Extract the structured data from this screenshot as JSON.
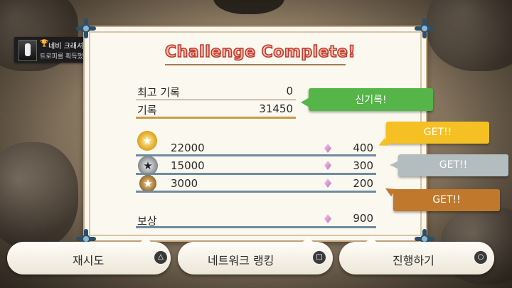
{
  "trophy": {
    "title": "네비 크래셔",
    "message": "트로피를 획득했습니다!",
    "cup_icon": "🏆",
    "ps_icon": "PS"
  },
  "title": "Challenge Complete!",
  "best_record": {
    "label": "최고 기록",
    "value": "0"
  },
  "record": {
    "label": "기록",
    "value": "31450"
  },
  "new_record_tag": "신기록!",
  "tiers": [
    {
      "medal": "gold-medal-icon",
      "score": "22000",
      "reward": "400",
      "tag": "GET!!",
      "tag_color": "#f5c024"
    },
    {
      "medal": "silver-medal-icon",
      "score": "15000",
      "reward": "300",
      "tag": "GET!!",
      "tag_color": "#b3bcbe"
    },
    {
      "medal": "bronze-medal-icon",
      "score": "3000",
      "reward": "200",
      "tag": "GET!!",
      "tag_color": "#c0792c"
    }
  ],
  "reward": {
    "label": "보상",
    "value": "900"
  },
  "buttons": {
    "retry": {
      "label": "재시도",
      "symbol": "△"
    },
    "ranking": {
      "label": "네트워크 랭킹",
      "symbol": "□"
    },
    "proceed": {
      "label": "진행하기",
      "symbol": "○"
    }
  },
  "colors": {
    "title_outline": "#c03a2e",
    "new_record": "#55b548",
    "card_border": "#c9a981"
  }
}
